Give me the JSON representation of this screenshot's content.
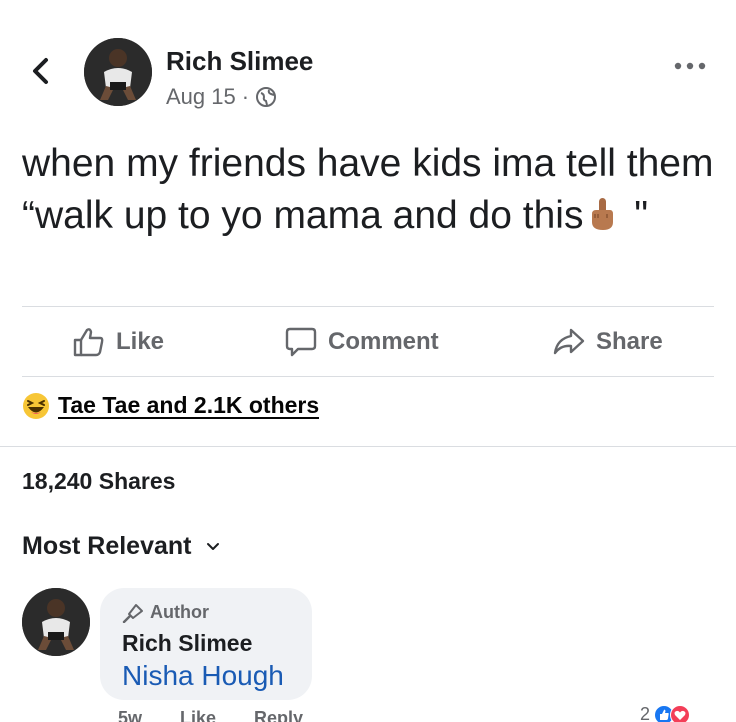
{
  "post": {
    "author": "Rich Slimee",
    "date": "Aug 15",
    "dot": "·",
    "text_before_emoji": "when my friends have kids ima tell them “walk up to yo mama and do this",
    "text_after_emoji": " \"",
    "privacy_icon": "globe-icon",
    "emoji_icon": "middle-finger-emoji"
  },
  "actions": {
    "like": "Like",
    "comment": "Comment",
    "share": "Share"
  },
  "reactions": {
    "text": "Tae Tae and 2.1K others",
    "icon": "haha-reaction-icon"
  },
  "shares": "18,240 Shares",
  "sort": {
    "label": "Most Relevant"
  },
  "comment": {
    "badge": "Author",
    "author": "Rich Slimee",
    "text": "Nisha Hough",
    "time": "5w",
    "like": "Like",
    "reply": "Reply",
    "reaction_count": "2"
  },
  "colors": {
    "text": "#1c1e21",
    "secondary": "#65676b",
    "link_blue": "#1a5bb4",
    "bubble": "#f0f2f5",
    "divider": "#dadde1",
    "like_blue": "#1877f2",
    "love_red": "#f33e58"
  }
}
